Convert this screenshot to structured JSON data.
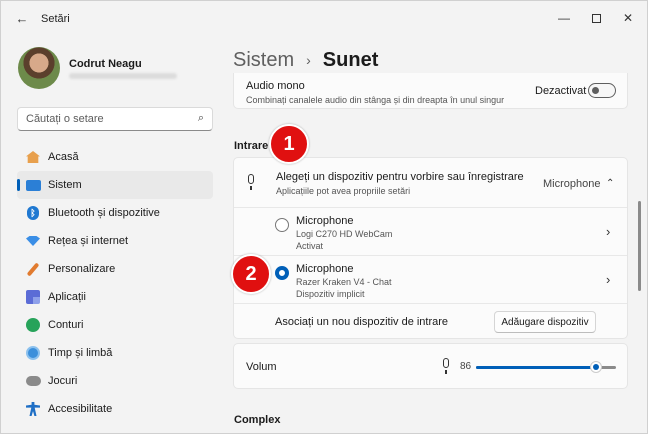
{
  "window": {
    "title": "Setări",
    "back_icon": "←",
    "minimize_icon": "—",
    "close_icon": "✕"
  },
  "user": {
    "name": "Codrut Neagu"
  },
  "search": {
    "placeholder": "Căutați o setare",
    "icon": "⌕"
  },
  "sidebar": {
    "items": [
      {
        "label": "Acasă",
        "icon": "home-icon"
      },
      {
        "label": "Sistem",
        "icon": "system-icon",
        "active": true
      },
      {
        "label": "Bluetooth și dispozitive",
        "icon": "bluetooth-icon"
      },
      {
        "label": "Rețea și internet",
        "icon": "network-icon"
      },
      {
        "label": "Personalizare",
        "icon": "brush-icon"
      },
      {
        "label": "Aplicații",
        "icon": "apps-icon"
      },
      {
        "label": "Conturi",
        "icon": "accounts-icon"
      },
      {
        "label": "Timp și limbă",
        "icon": "time-language-icon"
      },
      {
        "label": "Jocuri",
        "icon": "gaming-icon"
      },
      {
        "label": "Accesibilitate",
        "icon": "accessibility-icon"
      }
    ]
  },
  "breadcrumb": {
    "parent": "Sistem",
    "separator": "›",
    "current": "Sunet"
  },
  "mono_audio": {
    "title": "Audio mono",
    "description": "Combinați canalele audio din stânga și din dreapta în unul singur",
    "state": "Dezactivat"
  },
  "input_section": {
    "label": "Intrare",
    "header_title": "Alegeți un dispozitiv pentru vorbire sau înregistrare",
    "header_desc": "Aplicațiile pot avea propriile setări",
    "header_value": "Microphone",
    "chevron_up": "⌃",
    "chevron_right": "›",
    "devices": [
      {
        "name": "Microphone",
        "model": "Logi C270 HD WebCam",
        "status": "Activat",
        "selected": false
      },
      {
        "name": "Microphone",
        "model": "Razer Kraken V4 - Chat",
        "status": "Dispozitiv implicit",
        "selected": true
      }
    ],
    "add_text": "Asociați un nou dispozitiv de intrare",
    "add_button": "Adăugare dispozitiv"
  },
  "volume": {
    "label": "Volum",
    "value": "86",
    "level": 0.86
  },
  "complex_section": {
    "label": "Complex"
  },
  "markers": [
    "1",
    "2"
  ],
  "colors": {
    "accent": "#005fb8",
    "marker": "#e01010"
  }
}
